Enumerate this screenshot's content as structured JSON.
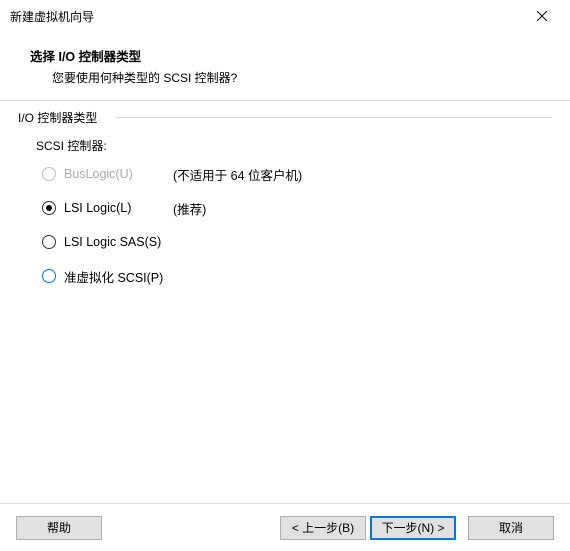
{
  "titlebar": {
    "title": "新建虚拟机向导"
  },
  "header": {
    "title": "选择 I/O 控制器类型",
    "subtitle": "您要使用何种类型的 SCSI 控制器?"
  },
  "group": {
    "legend": "I/O 控制器类型",
    "scsi_label": "SCSI 控制器:",
    "options": {
      "buslogic": {
        "label": "BusLogic(U)",
        "note": "(不适用于 64 位客户机)"
      },
      "lsilogic": {
        "label": "LSI Logic(L)",
        "note": "(推荐)"
      },
      "lsisas": {
        "label": "LSI Logic SAS(S)"
      },
      "pvscsi": {
        "label": "准虚拟化 SCSI(P)"
      }
    }
  },
  "footer": {
    "help": "帮助",
    "back": "< 上一步(B)",
    "next": "下一步(N) >",
    "cancel": "取消"
  }
}
